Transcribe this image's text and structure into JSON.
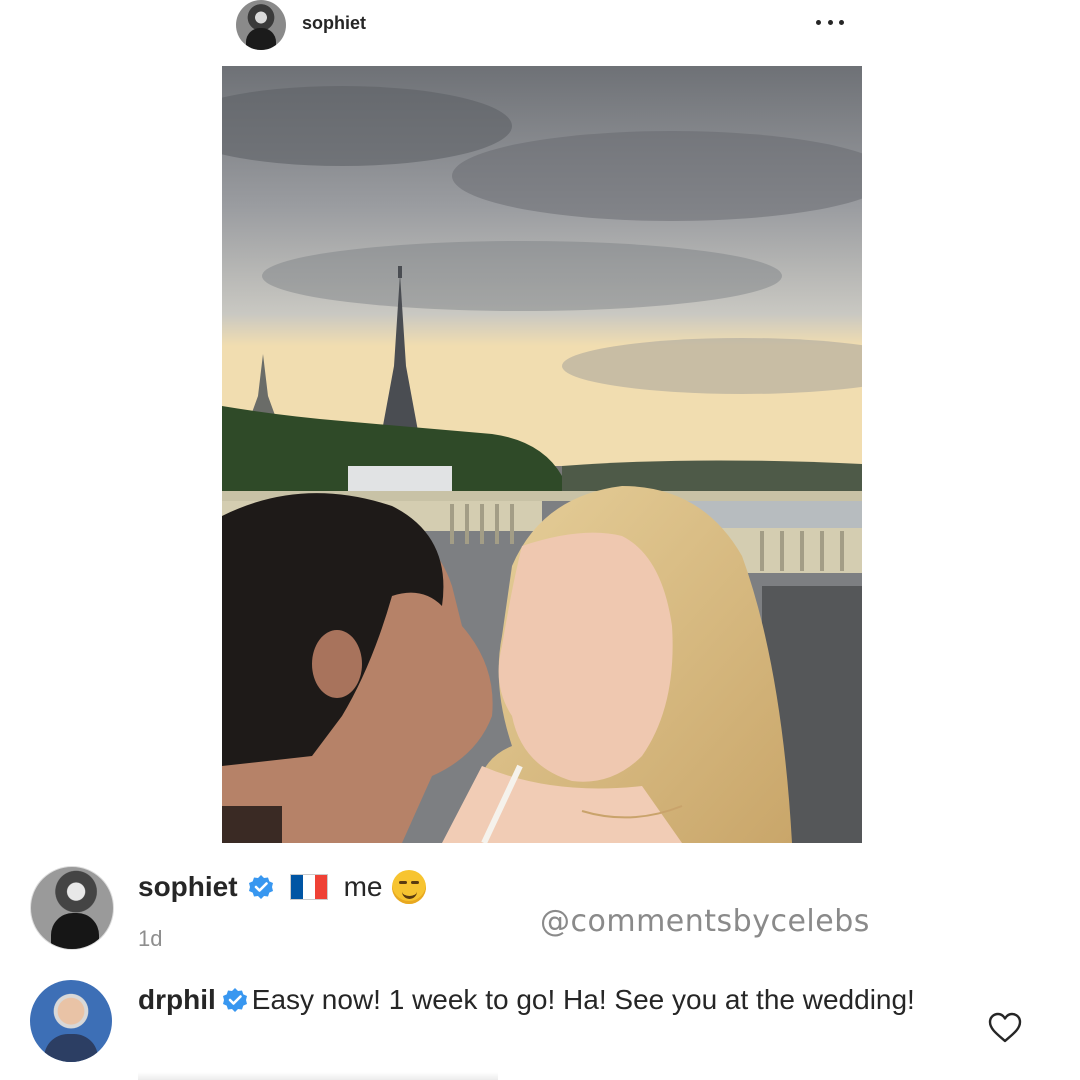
{
  "header": {
    "username": "sophiet",
    "more_icon": "more-horizontal-icon"
  },
  "post": {
    "image_alt": "photo"
  },
  "caption": {
    "username": "sophiet",
    "verified_icon": "verified-badge-icon",
    "flag_icon": "france-flag-icon",
    "text": "me",
    "emoji_icon": "smirking-face-emoji-icon",
    "time": "1d"
  },
  "watermark": {
    "text": "@commentsbycelebs"
  },
  "comment": {
    "username": "drphil",
    "verified_icon": "verified-badge-icon",
    "text": "Easy now! 1 week to go! Ha! See you at the wedding!",
    "like_icon": "heart-outline-icon"
  },
  "colors": {
    "text": "#262626",
    "secondary_text": "#8e8e8e",
    "verified_blue": "#3897f0",
    "flag_blue": "#0055a4",
    "flag_red": "#ef4135"
  }
}
